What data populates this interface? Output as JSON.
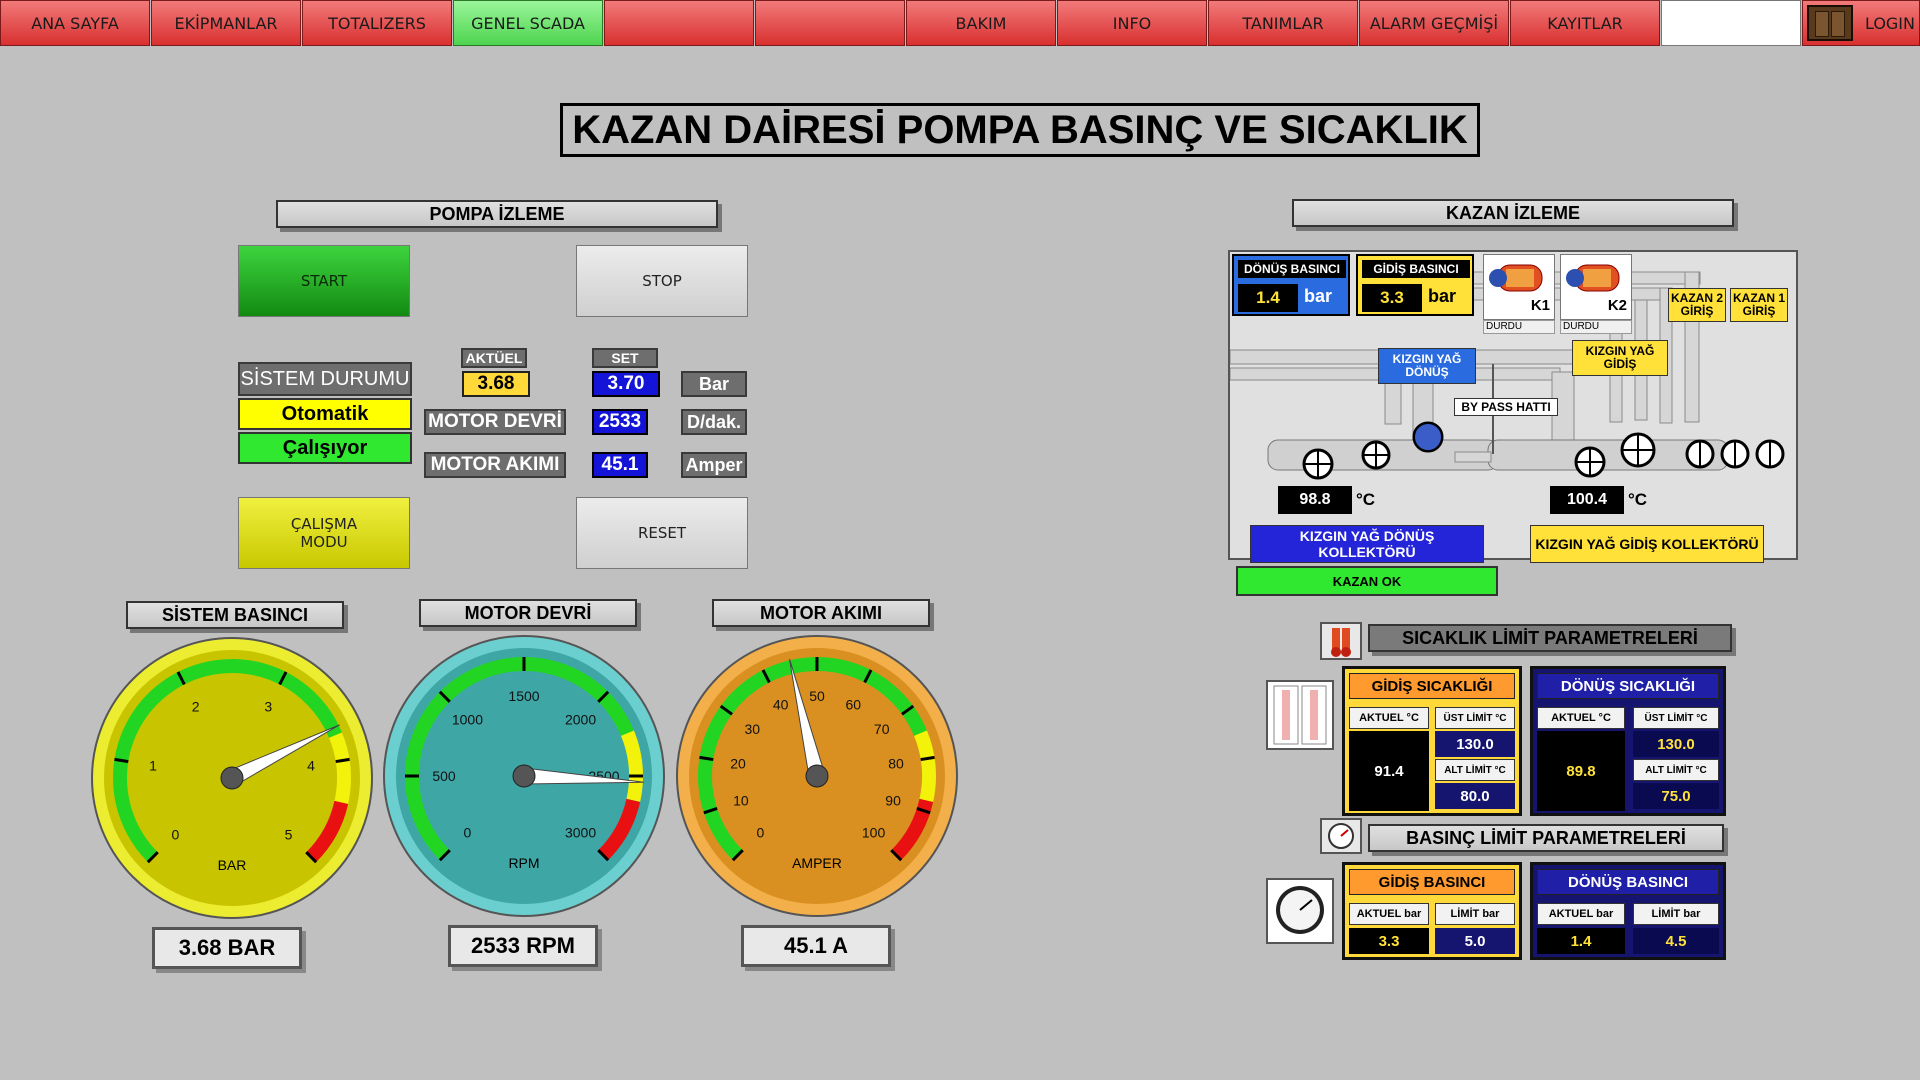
{
  "nav": {
    "items": [
      {
        "label": "ANA SAYFA"
      },
      {
        "label": "EKİPMANLAR"
      },
      {
        "label": "TOTALIZERS"
      },
      {
        "label": "GENEL SCADA"
      },
      {
        "label": ""
      },
      {
        "label": ""
      },
      {
        "label": "BAKIM"
      },
      {
        "label": "INFO"
      },
      {
        "label": "TANIMLAR"
      },
      {
        "label": "ALARM GEÇMİŞİ"
      },
      {
        "label": "KAYITLAR"
      },
      {
        "label": ""
      }
    ],
    "login": "LOGIN"
  },
  "title": "KAZAN DAİRESİ POMPA BASINÇ VE SICAKLIK",
  "pump": {
    "header": "POMPA İZLEME",
    "start": "START",
    "stop": "STOP",
    "mode_button": "ÇALIŞMA MODU",
    "reset": "RESET",
    "system_status_label": "SİSTEM DURUMU",
    "status_mode": "Otomatik",
    "status_run": "Çalışıyor",
    "col_actual": "AKTÜEL",
    "col_set": "SET",
    "pressure_actual": "3.68",
    "pressure_set": "3.70",
    "pressure_unit": "Bar",
    "motor_speed_label": "MOTOR DEVRİ",
    "motor_speed_value": "2533",
    "motor_speed_unit": "D/dak.",
    "motor_current_label": "MOTOR AKIMI",
    "motor_current_value": "45.1",
    "motor_current_unit": "Amper"
  },
  "gauges": [
    {
      "title": "SİSTEM BASINCI",
      "unit": "BAR",
      "min": 0,
      "max": 5,
      "value": 3.68,
      "ticks": [
        "0",
        "1",
        "2",
        "3",
        "4",
        "5"
      ],
      "readout": "3.68 BAR",
      "face": "#c8c400",
      "rim": "#ecec30"
    },
    {
      "title": "MOTOR DEVRİ",
      "unit": "RPM",
      "min": 0,
      "max": 3000,
      "value": 2533,
      "ticks": [
        "0",
        "500",
        "1000",
        "1500",
        "2000",
        "2500",
        "3000"
      ],
      "readout": "2533 RPM",
      "face": "#3fa6a6",
      "rim": "#6ccfcf"
    },
    {
      "title": "MOTOR AKIMI",
      "unit": "AMPER",
      "min": 0,
      "max": 100,
      "value": 45.1,
      "ticks": [
        "0",
        "10",
        "20",
        "30",
        "40",
        "50",
        "60",
        "70",
        "80",
        "90",
        "100"
      ],
      "readout": "45.1 A",
      "face": "#d99020",
      "rim": "#f3b04a"
    }
  ],
  "boiler": {
    "header": "KAZAN İZLEME",
    "return_pressure_label": "DÖNÜŞ BASINCI",
    "return_pressure_value": "1.4",
    "supply_pressure_label": "GİDİŞ BASINCI",
    "supply_pressure_value": "3.3",
    "pressure_unit": "bar",
    "k1_label": "K1",
    "k2_label": "K2",
    "k1_state": "DURDU",
    "k2_state": "DURDU",
    "kazan2_giris": "KAZAN 2 GİRİŞ",
    "kazan1_giris": "KAZAN 1 GİRİŞ",
    "hot_oil_return": "KIZGIN YAĞ DÖNÜŞ",
    "hot_oil_supply": "KIZGIN YAĞ GİDİŞ",
    "bypass": "BY PASS HATTI",
    "return_temp": "98.8",
    "supply_temp": "100.4",
    "temp_unit": "°C",
    "return_collector": "KIZGIN YAĞ DÖNÜŞ KOLLEKTÖRÜ",
    "supply_collector": "KIZGIN YAĞ GİDİŞ KOLLEKTÖRÜ",
    "boiler_ok": "KAZAN OK"
  },
  "temp_limits": {
    "header": "SICAKLIK LİMİT PARAMETRELERİ",
    "supply": {
      "title": "GİDİŞ SICAKLIĞI",
      "actual_label": "AKTUEL °C",
      "actual": "91.4",
      "upper_label": "ÜST LİMİT °C",
      "upper": "130.0",
      "lower_label": "ALT LİMİT °C",
      "lower": "80.0"
    },
    "return": {
      "title": "DÖNÜŞ SICAKLIĞI",
      "actual_label": "AKTUEL °C",
      "actual": "89.8",
      "upper_label": "ÜST LİMİT °C",
      "upper": "130.0",
      "lower_label": "ALT LİMİT °C",
      "lower": "75.0"
    }
  },
  "pressure_limits": {
    "header": "BASINÇ LİMİT PARAMETRELERİ",
    "supply": {
      "title": "GİDİŞ BASINCI",
      "actual_label": "AKTUEL bar",
      "actual": "3.3",
      "limit_label": "LİMİT bar",
      "limit": "5.0"
    },
    "return": {
      "title": "DÖNÜŞ BASINCI",
      "actual_label": "AKTUEL bar",
      "actual": "1.4",
      "limit_label": "LİMİT bar",
      "limit": "4.5"
    }
  },
  "colors": {
    "nav_red": "#e04a4a",
    "nav_active": "#6ee66e",
    "bg": "#c0c0c0",
    "value_yellow": "#ffd83a",
    "value_blue": "#1414d8"
  }
}
